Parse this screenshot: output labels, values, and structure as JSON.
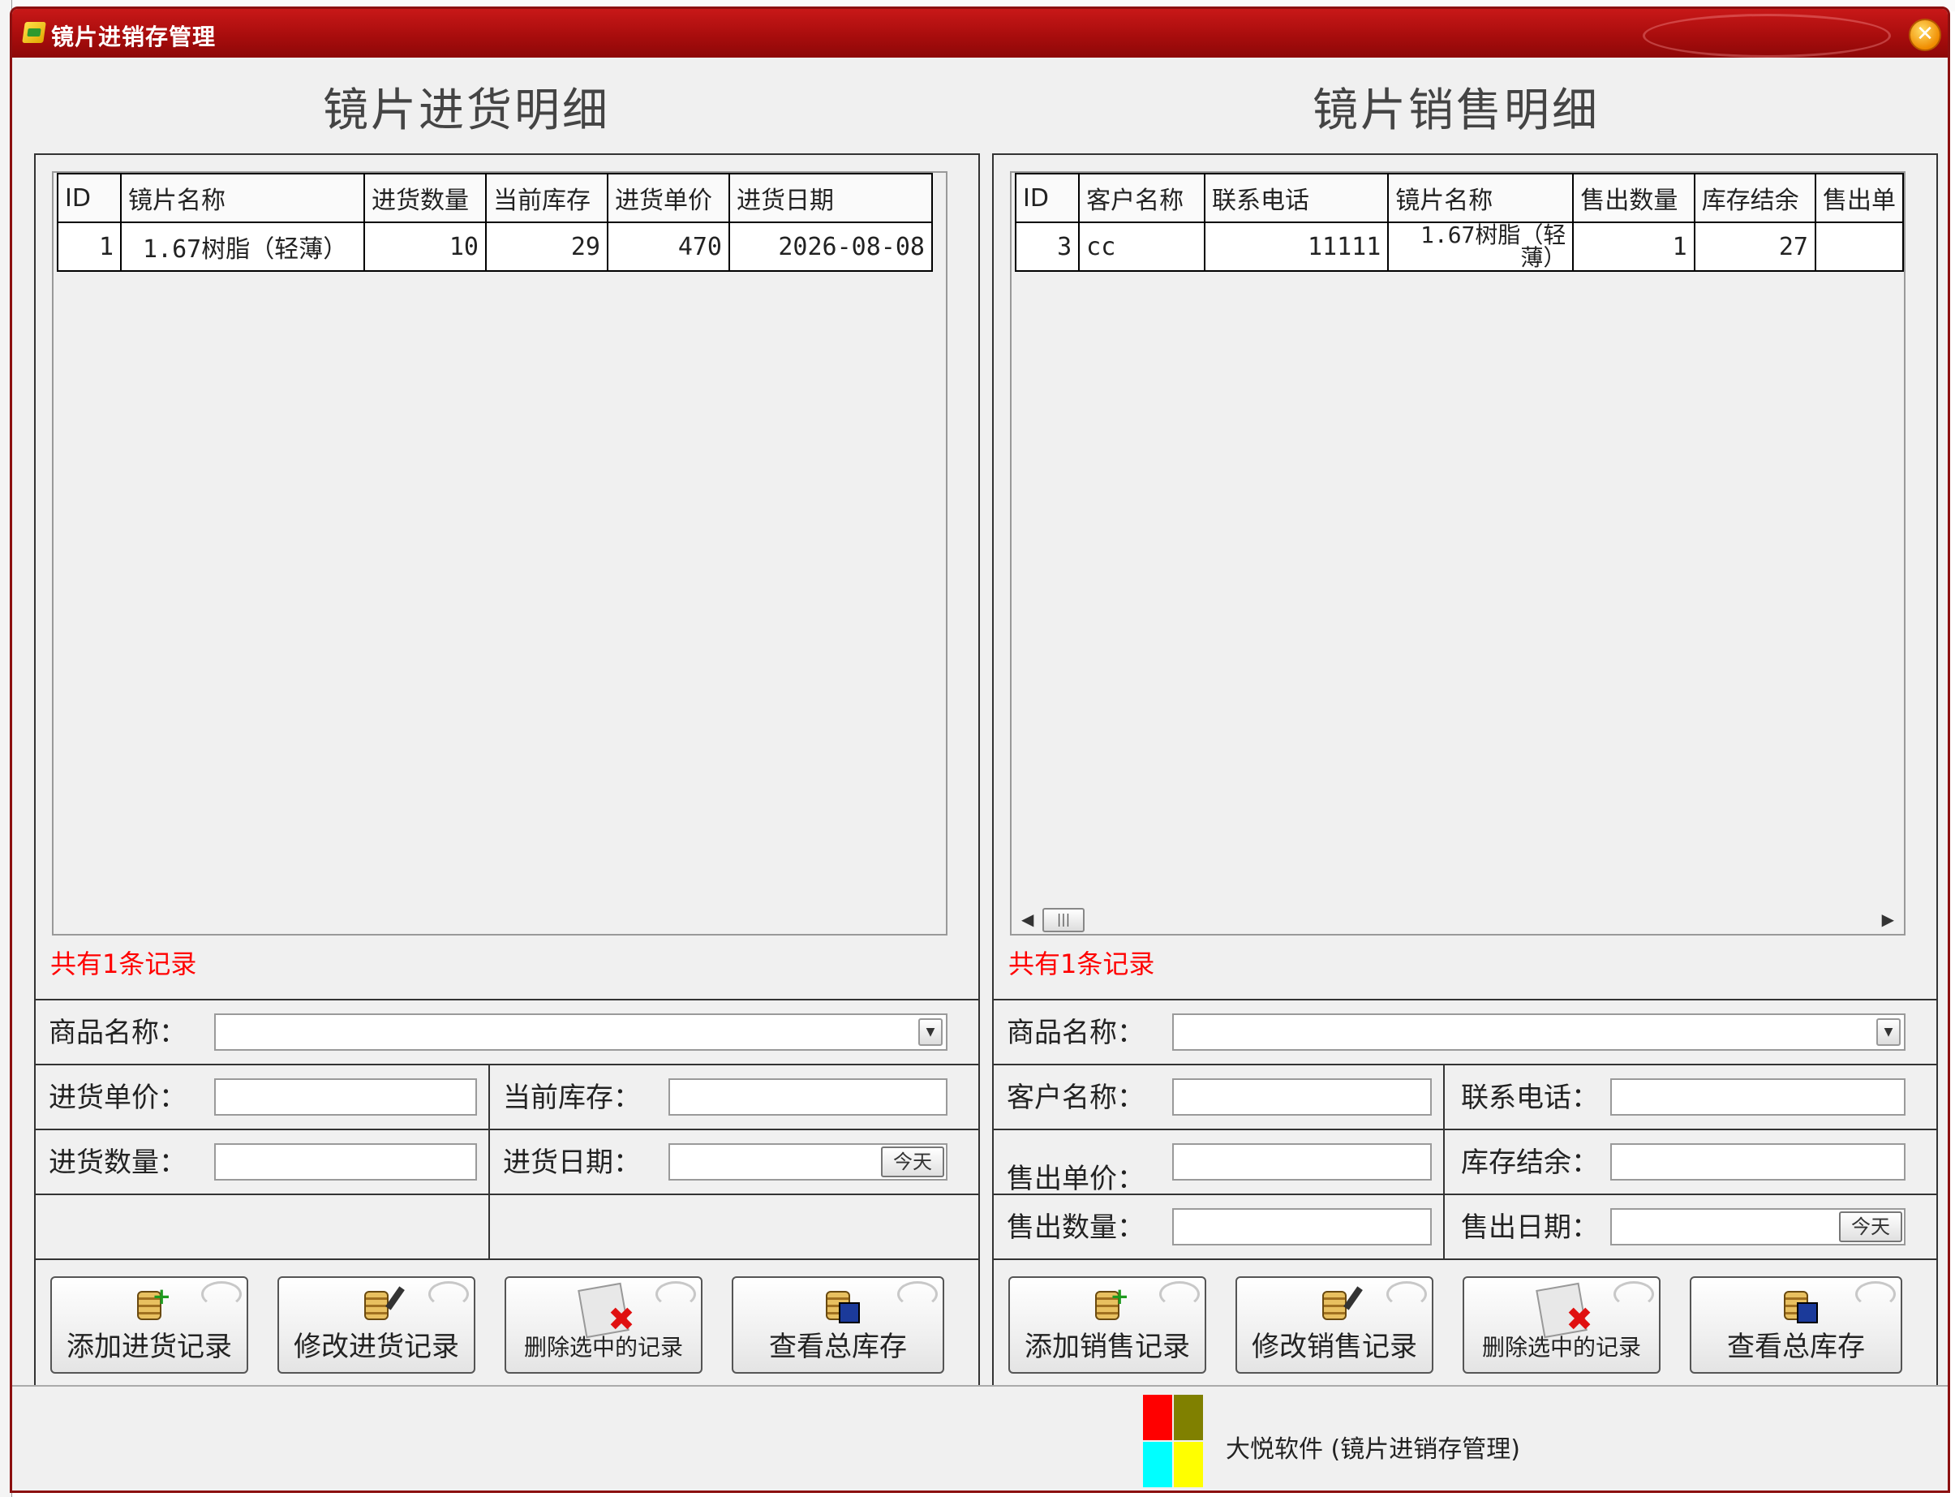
{
  "window": {
    "title": "镜片进销存管理",
    "close_symbol": "✕"
  },
  "purchase": {
    "title": "镜片进货明细",
    "table": {
      "columns": [
        "ID",
        "镜片名称",
        "进货数量",
        "当前库存",
        "进货单价",
        "进货日期"
      ],
      "rows": [
        [
          "1",
          "1.67树脂（轻薄）",
          "10",
          "29",
          "470",
          "2026-08-08"
        ]
      ]
    },
    "record_count": "共有1条记录",
    "form": {
      "product_name_label": "商品名称：",
      "unit_price_label": "进货单价：",
      "current_stock_label": "当前库存：",
      "quantity_label": "进货数量：",
      "date_label": "进货日期：",
      "today_label": "今天"
    },
    "buttons": {
      "add": "添加进货记录",
      "edit": "修改进货记录",
      "delete": "删除选中的记录",
      "view_stock": "查看总库存"
    }
  },
  "sales": {
    "title": "镜片销售明细",
    "table": {
      "columns": [
        "ID",
        "客户名称",
        "联系电话",
        "镜片名称",
        "售出数量",
        "库存结余",
        "售出单"
      ],
      "rows": [
        [
          "3",
          "cc",
          "11111",
          "1.67树脂（轻薄）",
          "1",
          "27",
          ""
        ]
      ]
    },
    "record_count": "共有1条记录",
    "form": {
      "product_name_label": "商品名称：",
      "customer_label": "客户名称：",
      "phone_label": "联系电话：",
      "unit_price_label": "售出单价：",
      "stock_balance_label": "库存结余：",
      "quantity_label": "售出数量：",
      "date_label": "售出日期：",
      "today_label": "今天"
    },
    "buttons": {
      "add": "添加销售记录",
      "edit": "修改销售记录",
      "delete": "删除选中的记录",
      "view_stock": "查看总库存"
    }
  },
  "statusbar": {
    "text": "大悦软件 (镜片进销存管理)",
    "logo_colors": [
      "#ff0000",
      "#808000",
      "#00ffff",
      "#ffff00"
    ]
  },
  "colors": {
    "title_red": "#b00e0e",
    "record_count_red": "#ff0000"
  }
}
